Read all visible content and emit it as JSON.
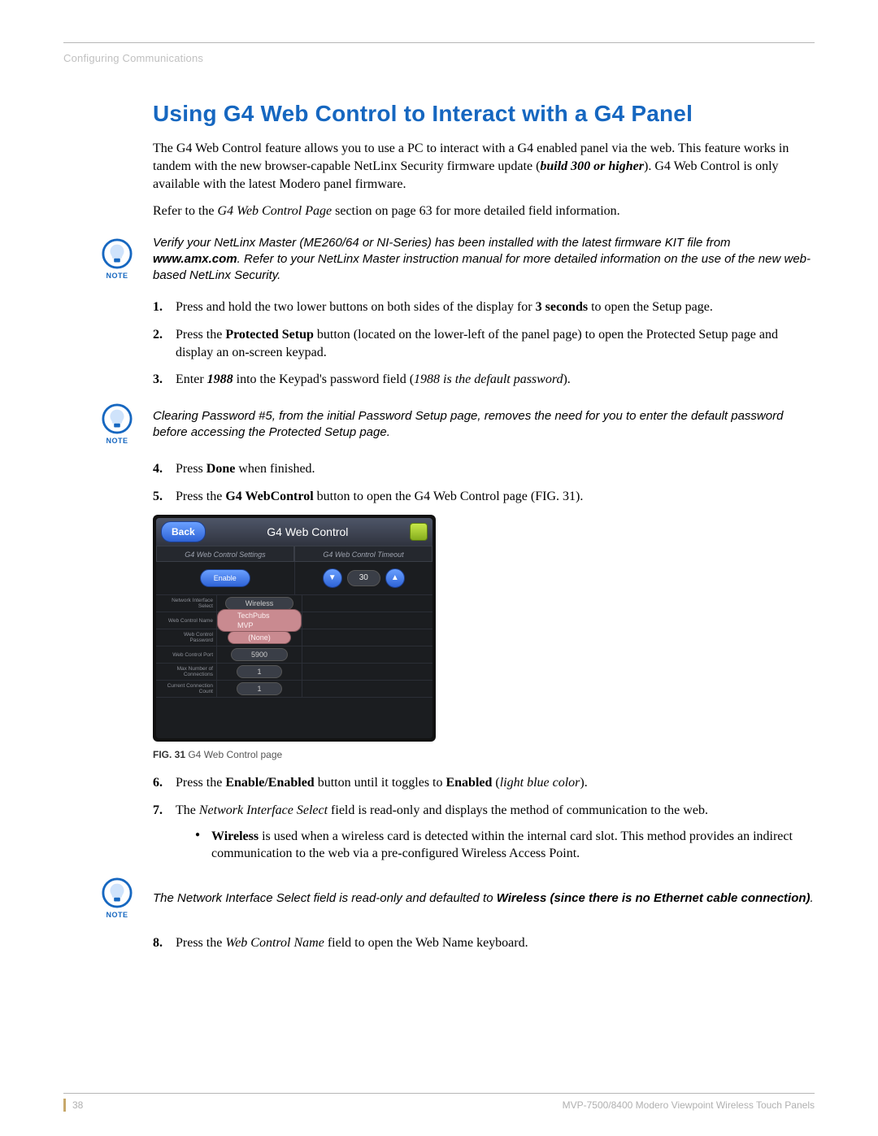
{
  "header": {
    "breadcrumb": "Configuring Communications"
  },
  "section_title": "Using G4 Web Control to Interact with a G4 Panel",
  "intro": {
    "p1_a": "The G4 Web Control feature allows you to use a PC to interact with a G4 enabled panel via the web. This feature works in tandem with the new browser-capable NetLinx Security firmware update (",
    "p1_b": "build 300 or higher",
    "p1_c": "). G4 Web Control is only available with the latest Modero panel firmware.",
    "p2_a": "Refer to the ",
    "p2_b": "G4 Web Control Page",
    "p2_c": " section on page 63 for more detailed field information."
  },
  "note1": {
    "label": "NOTE",
    "a": "Verify your NetLinx Master (ME260/64 or NI-Series) has been installed with the latest firmware KIT file from ",
    "b": "www.amx.com",
    "c": ". Refer to your NetLinx Master instruction manual for more detailed information on the use of the new web-based NetLinx Security."
  },
  "steps1": [
    {
      "n": "1.",
      "a": "Press and hold the two lower buttons on both sides of the display for ",
      "b": "3 seconds",
      "c": " to open the Setup page."
    },
    {
      "n": "2.",
      "a": "Press the ",
      "b": "Protected Setup",
      "c": " button (located on the lower-left of the panel page) to open the Protected Setup page and display an on-screen keypad."
    },
    {
      "n": "3.",
      "a": "Enter ",
      "b": "1988",
      "c": " into the Keypad's password field (",
      "d": "1988 is the default password",
      "e": ")."
    }
  ],
  "note2": {
    "label": "NOTE",
    "text": "Clearing Password #5, from the initial Password Setup page, removes the need for you to enter the default password before accessing the Protected Setup page."
  },
  "steps2": [
    {
      "n": "4.",
      "a": "Press ",
      "b": "Done",
      "c": " when finished."
    },
    {
      "n": "5.",
      "a": "Press the ",
      "b": "G4 WebControl",
      "c": " button to open the G4 Web Control page (FIG. 31)."
    }
  ],
  "figure": {
    "caption_label": "FIG. 31",
    "caption_text": "  G4 Web Control page",
    "panel": {
      "back": "Back",
      "title": "G4 Web Control",
      "tab_left": "G4 Web Control Settings",
      "tab_right": "G4 Web Control Timeout",
      "enable": "Enable",
      "timeout": "30",
      "rows": [
        {
          "label": "Network Interface Select",
          "value": "Wireless",
          "pink": false
        },
        {
          "label": "Web Control Name",
          "value": "TechPubs MVP",
          "pink": true
        },
        {
          "label": "Web Control Password",
          "value": "(None)",
          "pink": true
        },
        {
          "label": "Web Control Port",
          "value": "5900",
          "pink": false
        },
        {
          "label": "Max Number of Connections",
          "value": "1",
          "pink": false
        },
        {
          "label": "Current Connection Count",
          "value": "1",
          "pink": false
        }
      ]
    }
  },
  "steps3": [
    {
      "n": "6.",
      "a": "Press the ",
      "b": "Enable/Enabled",
      "c": " button until it toggles to ",
      "d": "Enabled",
      "e": " (",
      "f": "light blue color",
      "g": ")."
    },
    {
      "n": "7.",
      "a": "The ",
      "b": "Network Interface Select",
      "c": " field is read-only and displays the method of communication to the web."
    }
  ],
  "bullet7": {
    "a": "Wireless",
    "b": " is used when a wireless card is detected within the internal card slot. This method provides an indirect communication to the web via a pre-configured Wireless Access Point."
  },
  "note3": {
    "label": "NOTE",
    "a": "The Network Interface Select field is read-only and defaulted to ",
    "b": "Wireless (since there is no Ethernet cable connection)",
    "c": "."
  },
  "steps4": [
    {
      "n": "8.",
      "a": "Press the ",
      "b": "Web Control Name",
      "c": " field to open the Web Name keyboard."
    }
  ],
  "footer": {
    "page": "38",
    "doc": "MVP-7500/8400 Modero Viewpoint Wireless Touch Panels"
  }
}
